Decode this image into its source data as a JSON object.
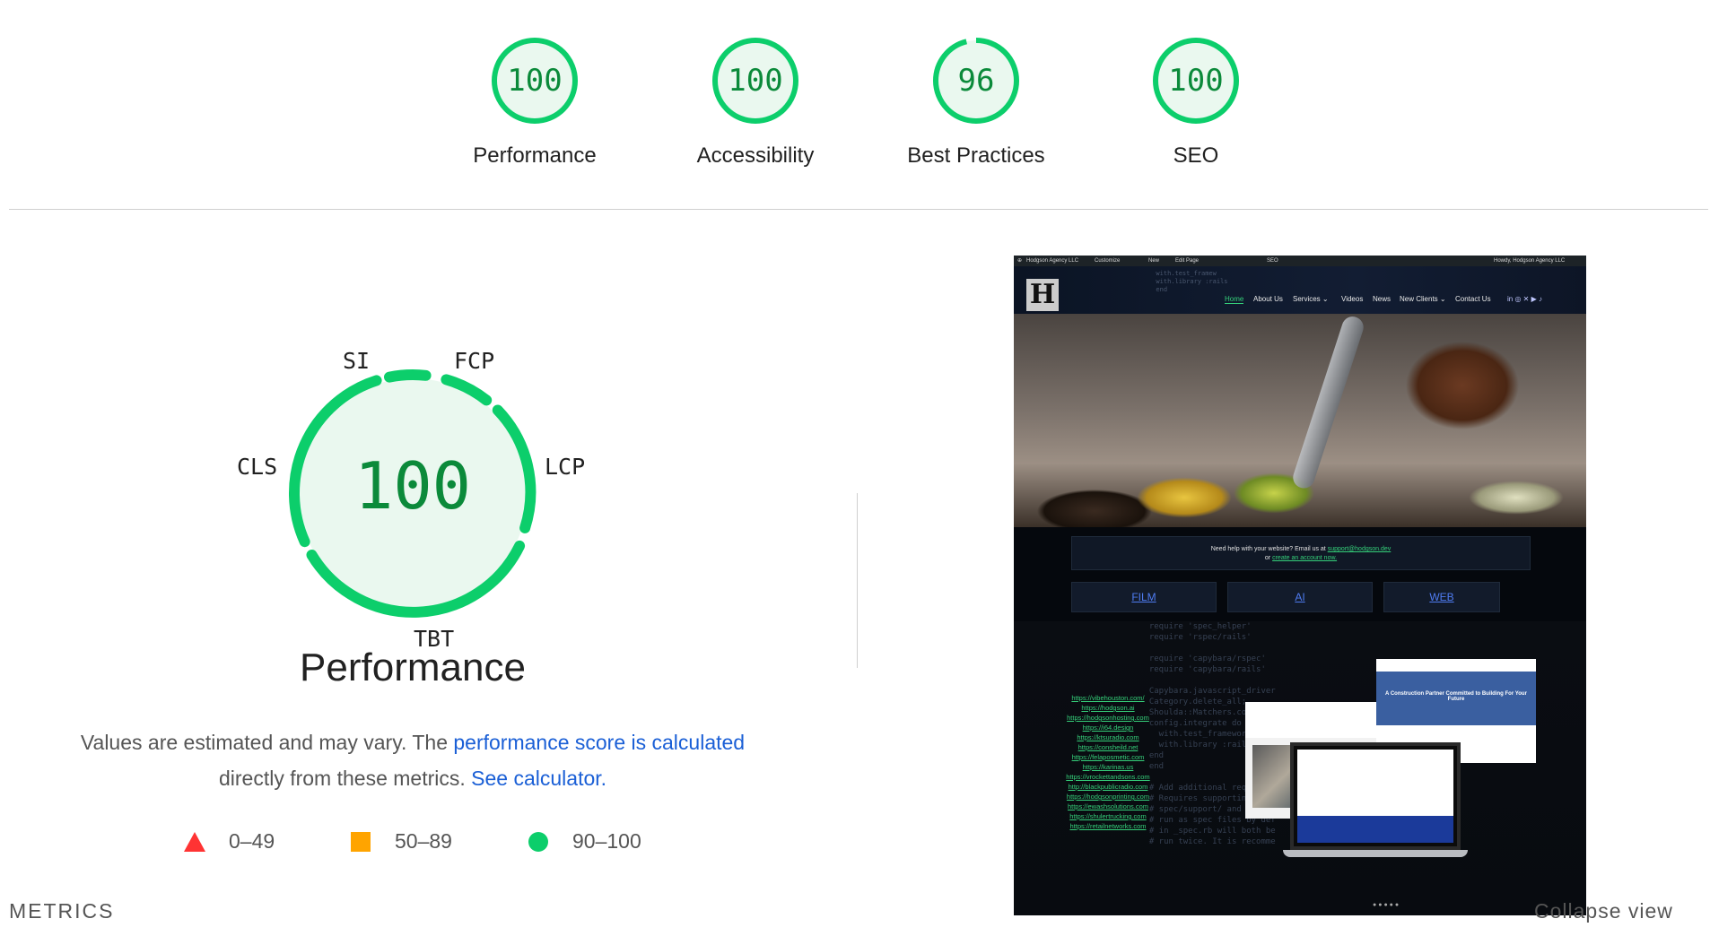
{
  "gauges": [
    {
      "score": "100",
      "label": "Performance",
      "value": 100
    },
    {
      "score": "100",
      "label": "Accessibility",
      "value": 100
    },
    {
      "score": "96",
      "label": "Best Practices",
      "value": 96
    },
    {
      "score": "100",
      "label": "SEO",
      "value": 100
    }
  ],
  "performance": {
    "score": "100",
    "title": "Performance",
    "metric_labels": {
      "si": "SI",
      "fcp": "FCP",
      "lcp": "LCP",
      "tbt": "TBT",
      "cls": "CLS"
    },
    "description_prefix": "Values are estimated and may vary. The ",
    "description_link": "performance score is calculated",
    "description_middle": " directly from these metrics. ",
    "description_link2": "See calculator."
  },
  "legend": {
    "fail": "0–49",
    "average": "50–89",
    "pass": "90–100"
  },
  "metrics_title": "METRICS",
  "collapse_label": "Collapse view",
  "colors": {
    "pass": "#0cce6b",
    "pass_fill": "#eaf8ef",
    "pass_text": "#0b8a3a",
    "average": "#ffa400",
    "fail": "#ff3333",
    "link": "#1a5fd6"
  },
  "screenshot": {
    "adminbar": {
      "site": "Hodgson Agency LLC",
      "customize": "Customize",
      "new": "New",
      "edit": "Edit Page",
      "seo": "SEO",
      "user": "Howdy, Hodgson Agency LLC"
    },
    "nav": [
      "Home",
      "About Us",
      "Services ⌄",
      "Videos",
      "News",
      "New Clients ⌄",
      "Contact Us"
    ],
    "help_text": "Need help with your website? Email us at",
    "help_email": "support@hodgson.dev",
    "help_or": "or",
    "help_link": "create an account now.",
    "buttons": [
      "FILM",
      "AI",
      "WEB"
    ],
    "links": [
      "https://vibehouston.com/",
      "https://hodgson.ai",
      "https://hodgsonhosting.com",
      "https://i64.design",
      "https://ktsuradio.com",
      "https://consheild.net",
      "https://felaposmetic.com",
      "https://karinas.us",
      "https://vrockettandsons.com",
      "http://blackpublicradio.com",
      "https://hodgsonprinting.com",
      "https://ewashsolutions.com",
      "https://shulertrucking.com",
      "https://retailnetworks.com"
    ],
    "card_headline": "A Construction Partner Committed to Building For Your Future"
  }
}
